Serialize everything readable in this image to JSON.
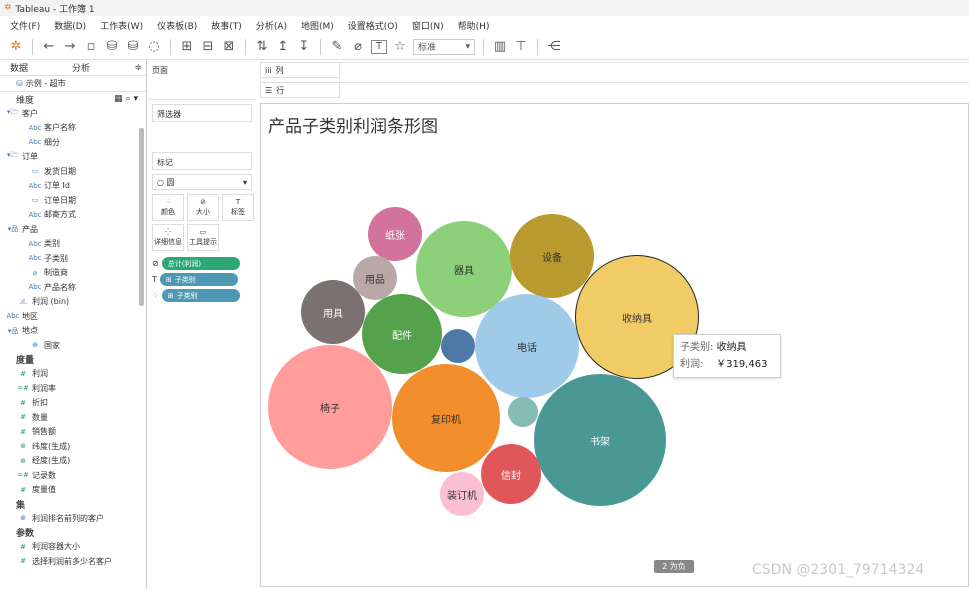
{
  "app": {
    "title": "Tableau - 工作簿 1"
  },
  "menu": [
    "文件(F)",
    "数据(D)",
    "工作表(W)",
    "仪表板(B)",
    "故事(T)",
    "分析(A)",
    "地图(M)",
    "设置格式(O)",
    "窗口(N)",
    "帮助(H)"
  ],
  "toolbar": {
    "fit_select": "标准"
  },
  "data_pane": {
    "tab_data": "数据",
    "tab_analysis": "分析",
    "datasource": "示例 - 超市",
    "dimensions_label": "维度",
    "dimension_rows": [
      {
        "icon": "▾🗁",
        "label": "客户",
        "indent": 0
      },
      {
        "icon": "Abc",
        "label": "客户名称",
        "indent": 2
      },
      {
        "icon": "Abc",
        "label": "细分",
        "indent": 2
      },
      {
        "icon": "▾🗁",
        "label": "订单",
        "indent": 0
      },
      {
        "icon": "▭",
        "label": "发货日期",
        "indent": 2
      },
      {
        "icon": "Abc",
        "label": "订单 Id",
        "indent": 2
      },
      {
        "icon": "▭",
        "label": "订单日期",
        "indent": 2
      },
      {
        "icon": "Abc",
        "label": "邮寄方式",
        "indent": 2
      },
      {
        "icon": "▾品",
        "label": "产品",
        "indent": 0
      },
      {
        "icon": "Abc",
        "label": "类别",
        "indent": 2
      },
      {
        "icon": "Abc",
        "label": "子类别",
        "indent": 2
      },
      {
        "icon": "⌀",
        "label": "制造商",
        "indent": 2
      },
      {
        "icon": "Abc",
        "label": "产品名称",
        "indent": 2
      },
      {
        "icon": ".ıl.",
        "label": "利润 (bin)",
        "indent": 1
      },
      {
        "icon": "Abc",
        "label": "地区",
        "indent": 0
      },
      {
        "icon": "▾品",
        "label": "地点",
        "indent": 0
      },
      {
        "icon": "⊕",
        "label": "国家",
        "indent": 2
      }
    ],
    "measures_label": "度量",
    "measure_rows": [
      {
        "icon": "#",
        "label": "利润"
      },
      {
        "icon": "=#",
        "label": "利润率"
      },
      {
        "icon": "#",
        "label": "折扣"
      },
      {
        "icon": "#",
        "label": "数量"
      },
      {
        "icon": "#",
        "label": "销售额"
      },
      {
        "icon": "⊕",
        "label": "纬度(生成)"
      },
      {
        "icon": "⊕",
        "label": "经度(生成)"
      },
      {
        "icon": "=#",
        "label": "记录数"
      },
      {
        "icon": "#",
        "label": "度量值"
      }
    ],
    "sets_label": "集",
    "set_rows": [
      {
        "icon": "⊗",
        "label": "利润排名前列的客户"
      }
    ],
    "params_label": "参数",
    "param_rows": [
      {
        "icon": "#",
        "label": "利润容器大小"
      },
      {
        "icon": "#",
        "label": "选择利润前多少名客户"
      }
    ]
  },
  "pages_label": "页面",
  "filters_label": "筛选器",
  "marks": {
    "label": "标记",
    "type": "圆",
    "buttons": [
      "颜色",
      "大小",
      "标签",
      "详细信息",
      "工具提示"
    ],
    "pills": [
      {
        "label": "总计(利润)",
        "color": "#2aa876"
      },
      {
        "label": "子类别",
        "color": "#4e98b3"
      },
      {
        "label": "子类别",
        "color": "#4e98b3"
      }
    ]
  },
  "shelves": {
    "columns": "列",
    "rows": "行"
  },
  "view": {
    "title": "产品子类别利润条形图",
    "bubbles": [
      {
        "label": "纸张",
        "color": "#d3729c",
        "text_color": "#ffffff"
      },
      {
        "label": "用品",
        "color": "#b8a9a6",
        "text_color": "#333333"
      },
      {
        "label": "器具",
        "color": "#8dd07a",
        "text_color": "#333333"
      },
      {
        "label": "设备",
        "color": "#b89a2e",
        "text_color": "#333333"
      },
      {
        "label": "收纳具",
        "color": "#f1cc66",
        "text_color": "#333333"
      },
      {
        "label": "用具",
        "color": "#7a7170",
        "text_color": "#ffffff"
      },
      {
        "label": "配件",
        "color": "#54a24b",
        "text_color": "#ffffff"
      },
      {
        "label": "",
        "color": "#4e79a7",
        "text_color": "#ffffff"
      },
      {
        "label": "电话",
        "color": "#a0cbe8",
        "text_color": "#333333"
      },
      {
        "label": "椅子",
        "color": "#ff9d9a",
        "text_color": "#333333"
      },
      {
        "label": "复印机",
        "color": "#f28e2b",
        "text_color": "#333333"
      },
      {
        "label": "",
        "color": "#86bcb6",
        "text_color": "#ffffff"
      },
      {
        "label": "书架",
        "color": "#499894",
        "text_color": "#ffffff"
      },
      {
        "label": "信封",
        "color": "#e15759",
        "text_color": "#ffffff"
      },
      {
        "label": "装订机",
        "color": "#fabfd2",
        "text_color": "#333333"
      }
    ]
  },
  "tooltip": {
    "k1": "子类别:",
    "v1": "收纳具",
    "k2": "利润:",
    "v2": "￥319,463"
  },
  "status": {
    "marks_count": "2 为负"
  },
  "watermark": "CSDN @2301_79714324"
}
